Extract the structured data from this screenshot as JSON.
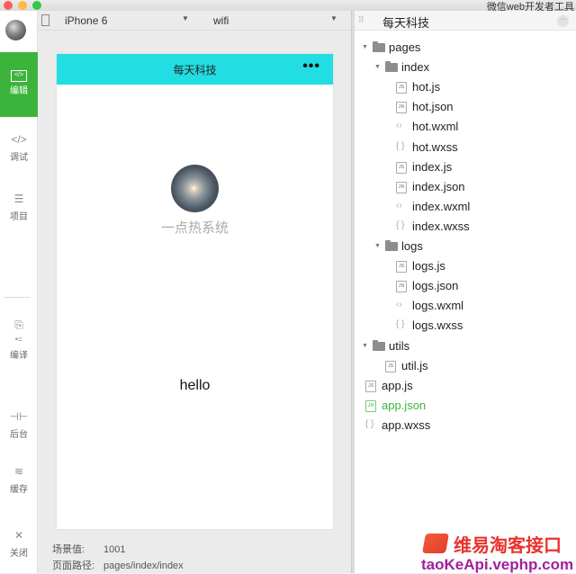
{
  "window": {
    "app_title": "微信web开发者工具"
  },
  "sidebar": {
    "items": [
      {
        "id": "edit",
        "label": "编辑",
        "icon": "code-box-icon",
        "active": true
      },
      {
        "id": "debug",
        "label": "调试",
        "icon": "code-brackets-icon"
      },
      {
        "id": "project",
        "label": "项目",
        "icon": "menu-lines-icon"
      },
      {
        "id": "compile",
        "label": "编译",
        "icon": "compile-icon"
      },
      {
        "id": "backend",
        "label": "后台",
        "icon": "backend-icon"
      },
      {
        "id": "cache",
        "label": "缓存",
        "icon": "layers-icon"
      },
      {
        "id": "close",
        "label": "关闭",
        "icon": "close-icon"
      }
    ],
    "active_color": "#3cb43c"
  },
  "toolbar": {
    "device": "iPhone 6",
    "network": "wifi"
  },
  "simulator": {
    "nav_title": "每天科技",
    "nav_color": "#22dde1",
    "more_glyph": "•••",
    "user_name": "一点热系统",
    "motto": "hello",
    "scene_label": "场景值:",
    "scene_value": "1001",
    "path_label": "页面路径:",
    "path_value": "pages/index/index"
  },
  "file_tree": {
    "project_name": "每天科技",
    "more_glyph": "···",
    "rows": [
      {
        "name": "pages",
        "type": "folder",
        "depth": 0
      },
      {
        "name": "index",
        "type": "folder",
        "depth": 1
      },
      {
        "name": "hot.js",
        "type": "js",
        "depth": 2
      },
      {
        "name": "hot.json",
        "type": "json",
        "depth": 2
      },
      {
        "name": "hot.wxml",
        "type": "wxml",
        "depth": 2
      },
      {
        "name": "hot.wxss",
        "type": "wxss",
        "depth": 2
      },
      {
        "name": "index.js",
        "type": "js",
        "depth": 2
      },
      {
        "name": "index.json",
        "type": "json",
        "depth": 2
      },
      {
        "name": "index.wxml",
        "type": "wxml",
        "depth": 2
      },
      {
        "name": "index.wxss",
        "type": "wxss",
        "depth": 2
      },
      {
        "name": "logs",
        "type": "folder",
        "depth": 1
      },
      {
        "name": "logs.js",
        "type": "js",
        "depth": 2
      },
      {
        "name": "logs.json",
        "type": "json",
        "depth": 2
      },
      {
        "name": "logs.wxml",
        "type": "wxml",
        "depth": 2
      },
      {
        "name": "logs.wxss",
        "type": "wxss",
        "depth": 2
      },
      {
        "name": "utils",
        "type": "folder",
        "depth": 0
      },
      {
        "name": "util.js",
        "type": "js",
        "depth": 1
      },
      {
        "name": "app.js",
        "type": "js",
        "depth": -1
      },
      {
        "name": "app.json",
        "type": "json",
        "depth": -1,
        "active": true
      },
      {
        "name": "app.wxss",
        "type": "wxss",
        "depth": -1
      }
    ]
  },
  "watermark": {
    "cn": "维易淘客接口",
    "url": "taoKeApi.vephp.com"
  }
}
